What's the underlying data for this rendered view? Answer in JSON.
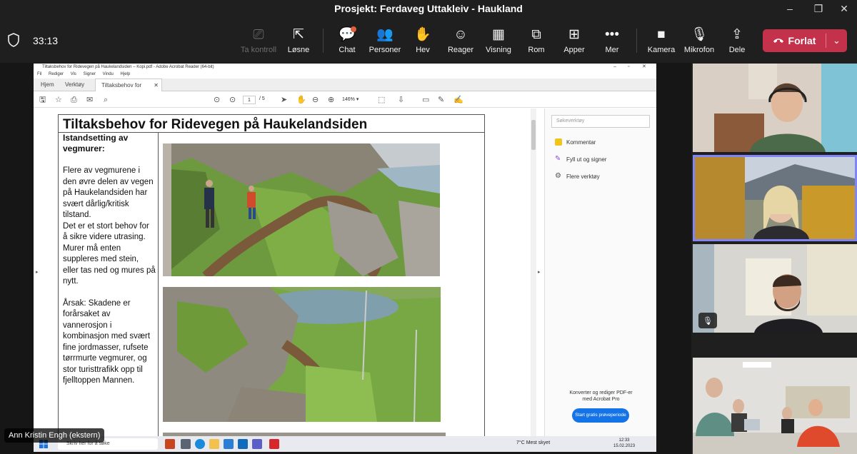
{
  "window": {
    "title": "Prosjekt: Ferdaveg Uttakleiv - Haukland",
    "minimize": "–",
    "maximize": "❐",
    "close": "✕"
  },
  "meeting": {
    "timer": "33:13",
    "toolbar": [
      {
        "id": "ta-kontroll",
        "label": "Ta kontroll",
        "icon": "screen-control-icon",
        "glyph": "⎚",
        "disabled": true
      },
      {
        "id": "losne",
        "label": "Løsne",
        "icon": "popout-icon",
        "glyph": "⇱"
      },
      {
        "id": "chat",
        "label": "Chat",
        "icon": "chat-icon",
        "glyph": "💬"
      },
      {
        "id": "personer",
        "label": "Personer",
        "icon": "people-icon",
        "glyph": "👥"
      },
      {
        "id": "hev",
        "label": "Hev",
        "icon": "raise-hand-icon",
        "glyph": "✋"
      },
      {
        "id": "reager",
        "label": "Reager",
        "icon": "smiley-icon",
        "glyph": "☺"
      },
      {
        "id": "visning",
        "label": "Visning",
        "icon": "grid-view-icon",
        "glyph": "▦"
      },
      {
        "id": "rom",
        "label": "Rom",
        "icon": "breakout-rooms-icon",
        "glyph": "⧉"
      },
      {
        "id": "apper",
        "label": "Apper",
        "icon": "add-app-icon",
        "glyph": "⊞"
      },
      {
        "id": "mer",
        "label": "Mer",
        "icon": "more-icon",
        "glyph": "•••"
      },
      {
        "id": "kamera",
        "label": "Kamera",
        "icon": "camera-icon",
        "glyph": "■"
      },
      {
        "id": "mikrofon",
        "label": "Mikrofon",
        "icon": "microphone-icon",
        "glyph": "🎙"
      },
      {
        "id": "dele",
        "label": "Dele",
        "icon": "share-icon",
        "glyph": "⇪"
      }
    ],
    "leave_label": "Forlat",
    "leave_color": "#c4314b",
    "presenter_name": "Ann Kristin Engh (ekstern)"
  },
  "acrobat": {
    "title": "Tiltaksbehov for Ridevegen på Haukelandsiden – Kopi.pdf - Adobe Acrobat Reader (64-bit)",
    "menu": [
      "Fil",
      "Rediger",
      "Vis",
      "Signer",
      "Vindu",
      "Hjelp"
    ],
    "tabs": {
      "home": "Hjem",
      "tools": "Verktøy",
      "doc": "Tiltaksbehov for Rid..."
    },
    "page_current": "1",
    "page_total": "/ 5",
    "zoom": "146%",
    "side": {
      "search_placeholder": "Søkeverktøy",
      "items": [
        "Kommentar",
        "Fyll ut og signer",
        "Flere verktøy"
      ],
      "promo": "Konverter og rediger PDF-er med Acrobat Pro",
      "trial_button": "Start gratis prøveperiode"
    }
  },
  "document": {
    "title": "Tiltaksbehov for Ridevegen på Haukelandsiden",
    "heading": "Istandsetting av vegmurer:",
    "para1": "Flere av vegmurene i den øvre delen av vegen på Haukelandsiden har svært dårlig/kritisk tilstand.",
    "para2": "Det er et stort behov for å sikre videre utrasing. Murer må enten suppleres med stein, eller tas ned og mures på nytt.",
    "para3": "Årsak: Skadene er forårsaket av vannerosjon i kombinasjon med svært fine jordmasser, rufsete tørrmurte vegmurer, og stor turisttrafikk opp til fjelltoppen Mannen."
  },
  "taskbar": {
    "search_placeholder": "Skriv her for å søke",
    "weather": "7°C  Mest skyet",
    "time": "12:33",
    "date": "15.02.2023"
  }
}
